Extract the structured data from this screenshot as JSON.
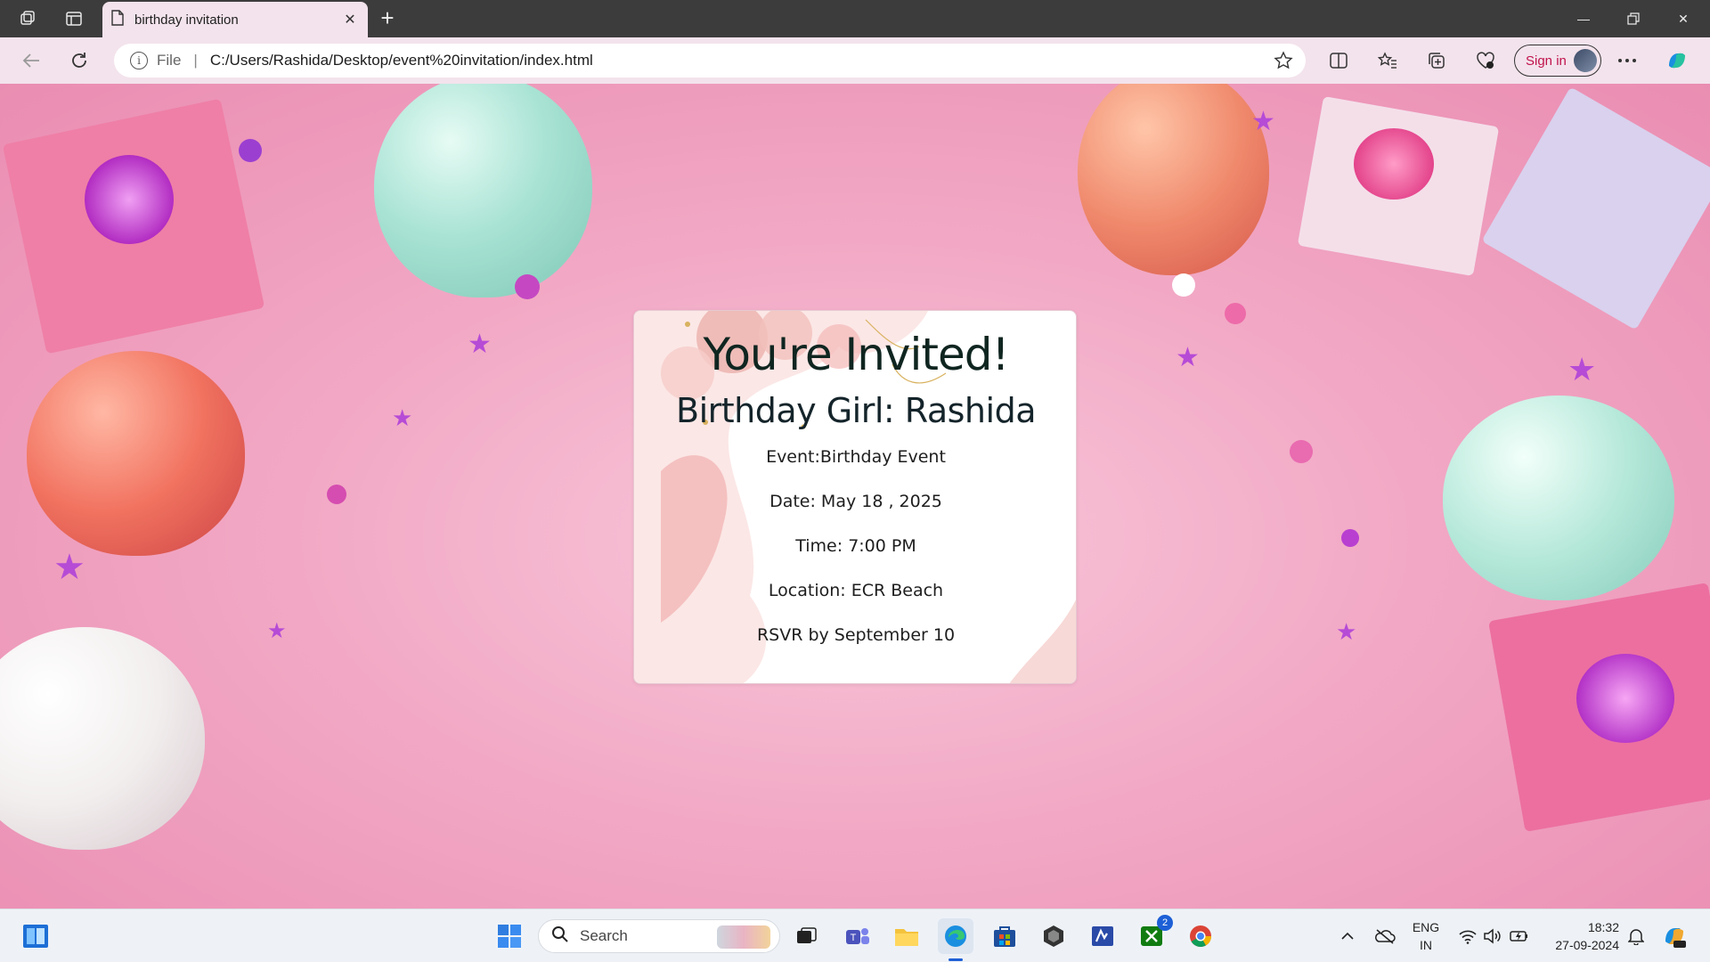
{
  "browser": {
    "tab_title": "birthday invitation",
    "address_scheme": "File",
    "address_url": "C:/Users/Rashida/Desktop/event%20invitation/index.html",
    "signin_label": "Sign in"
  },
  "invitation": {
    "heading": "You're Invited!",
    "subheading": "Birthday Girl: Rashida",
    "event": "Event:Birthday Event",
    "date": "Date: May 18 , 2025",
    "time": "Time: 7:00 PM",
    "location": "Location: ECR Beach",
    "rsvp": "RSVR by September 10"
  },
  "taskbar": {
    "search_label": "Search",
    "xbox_badge": "2",
    "lang_top": "ENG",
    "lang_bottom": "IN",
    "time": "18:32",
    "date": "27-09-2024"
  }
}
